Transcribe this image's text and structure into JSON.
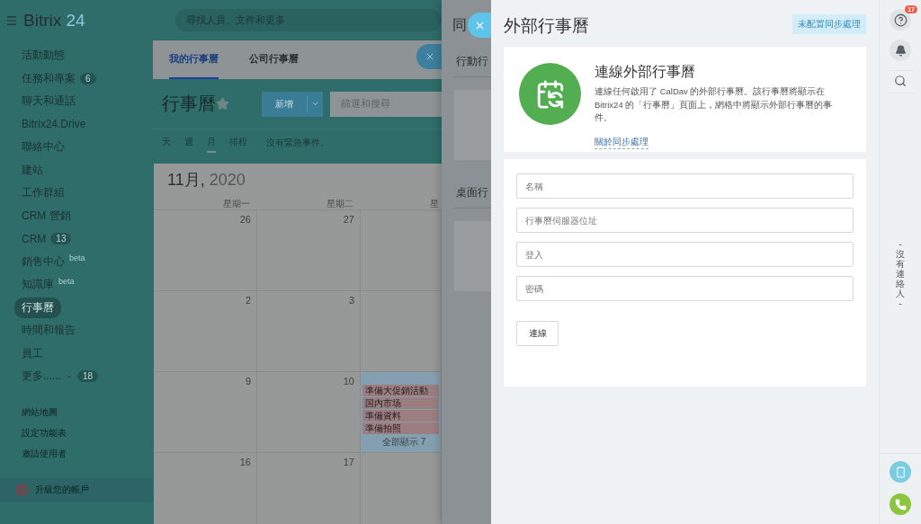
{
  "header": {
    "logo": "Bitrix",
    "logo_number": "24",
    "search_placeholder": "尋找人員、文件和更多"
  },
  "sidebar": {
    "items": [
      {
        "label": "活動動態",
        "selected": false
      },
      {
        "label": "任務和專案",
        "count": "6",
        "selected": false
      },
      {
        "label": "聊天和通話",
        "selected": false
      },
      {
        "label": "Bitrix24.Drive",
        "selected": false
      },
      {
        "label": "聯絡中心",
        "selected": false
      },
      {
        "label": "建站",
        "selected": false
      },
      {
        "label": "工作群組",
        "selected": false
      },
      {
        "label": "CRM 營銷",
        "selected": false
      },
      {
        "label": "CRM",
        "count": "13",
        "selected": false
      },
      {
        "label": "銷售中心",
        "tag": "beta",
        "selected": false
      },
      {
        "label": "知識庫",
        "tag": "beta",
        "selected": false
      },
      {
        "label": "行事曆",
        "selected": true
      },
      {
        "label": "時間和報告",
        "selected": false
      },
      {
        "label": "員工",
        "selected": false
      },
      {
        "label": "更多......",
        "count": "18",
        "dropdown": true,
        "selected": false
      }
    ],
    "links": [
      "網站地圖",
      "設定功能表",
      "邀請使用者"
    ],
    "upgrade": "升級您的帳戶"
  },
  "calendar": {
    "tabs": [
      {
        "label": "我的行事曆",
        "selected": true
      },
      {
        "label": "公司行事曆",
        "selected": false
      }
    ],
    "title": "行事曆",
    "add_button": "新增",
    "filter_placeholder": "篩選和搜尋",
    "views": [
      {
        "label": "天",
        "selected": false
      },
      {
        "label": "週",
        "selected": false
      },
      {
        "label": "月",
        "selected": true
      },
      {
        "label": "排程",
        "selected": false
      }
    ],
    "notice": "沒有緊急事件。",
    "month": "11月,",
    "year": "2020",
    "weekdays": [
      "星期一",
      "星期二",
      "星"
    ],
    "weeks": [
      {
        "days": [
          {
            "date": "26",
            "today": false
          },
          {
            "date": "27",
            "today": false
          },
          {
            "today": false
          }
        ]
      },
      {
        "days": [
          {
            "date": "2",
            "today": false
          },
          {
            "date": "3",
            "today": false
          },
          {
            "today": false
          }
        ]
      },
      {
        "days": [
          {
            "date": "9",
            "today": false
          },
          {
            "date": "10",
            "today": false
          },
          {
            "today": true,
            "events": [
              "準備大促銷活動",
              "国内市场",
              "準備資料",
              "準備拍照"
            ],
            "more": "全部顯示 7"
          }
        ]
      },
      {
        "days": [
          {
            "date": "16",
            "today": false
          },
          {
            "date": "17",
            "today": false
          },
          {
            "today": false
          }
        ]
      }
    ]
  },
  "back_slider": {
    "title": "同",
    "sections": [
      "行動行",
      "桌面行"
    ]
  },
  "slider": {
    "title": "外部行事曆",
    "status": "未配置同步處理",
    "intro": {
      "heading": "連線外部行事曆",
      "text": "連線任何啟用了 CalDav 的外部行事曆。該行事曆將顯示在 Bitrix24 的「行事曆」頁面上，網格中將顯示外部行事曆的事件。",
      "link": "關於同步處理"
    },
    "fields": [
      {
        "placeholder": "名稱"
      },
      {
        "placeholder": "行事曆伺服器位址"
      },
      {
        "placeholder": "登入"
      },
      {
        "placeholder": "密碼"
      }
    ],
    "connect_button": "連線"
  },
  "right_bar": {
    "help_count": "17",
    "empty_contacts": "- 沒有連絡人 -"
  }
}
